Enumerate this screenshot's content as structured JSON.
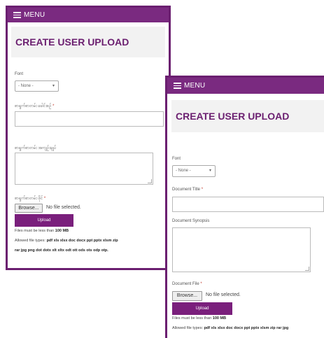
{
  "left": {
    "menu_label": "MENU",
    "title": "CREATE USER UPLOAD",
    "font_label": "Font",
    "font_value": "- None -",
    "doc_title_label": "စာရွက်စာတမ်း ခေါင်းစဉ်",
    "doc_synopsis_label": "စာရွက်စာတမ်း အကျဉ်းချုပ်",
    "doc_file_label": "စာရွက်စာတမ်း ဖိုင်",
    "required_mark": "*",
    "browse_label": "Browse...",
    "file_status": "No file selected.",
    "upload_label": "Upload",
    "size_note_prefix": "Files must be less than",
    "size_note_value": "100 MB",
    "types_prefix": "Allowed file types:",
    "types_line1": "pdf xls xlsx doc docx ppt pptx xlsm zip",
    "types_line2": "rar jpg png dot dotx xlt xltx odt ott ods ots odp otp."
  },
  "right": {
    "menu_label": "MENU",
    "title": "CREATE USER UPLOAD",
    "font_label": "Font",
    "font_value": "- None -",
    "doc_title_label": "Document Title",
    "doc_synopsis_label": "Document Synopsis",
    "doc_file_label": "Document File",
    "required_mark": "*",
    "browse_label": "Browse...",
    "file_status": "No file selected.",
    "upload_label": "Upload",
    "size_note_prefix": "Files must be less than",
    "size_note_value": "100 MB",
    "types_prefix": "Allowed file types:",
    "types_line1": "pdf xls xlsx doc docx ppt pptx xlsm zip rar jpg"
  }
}
